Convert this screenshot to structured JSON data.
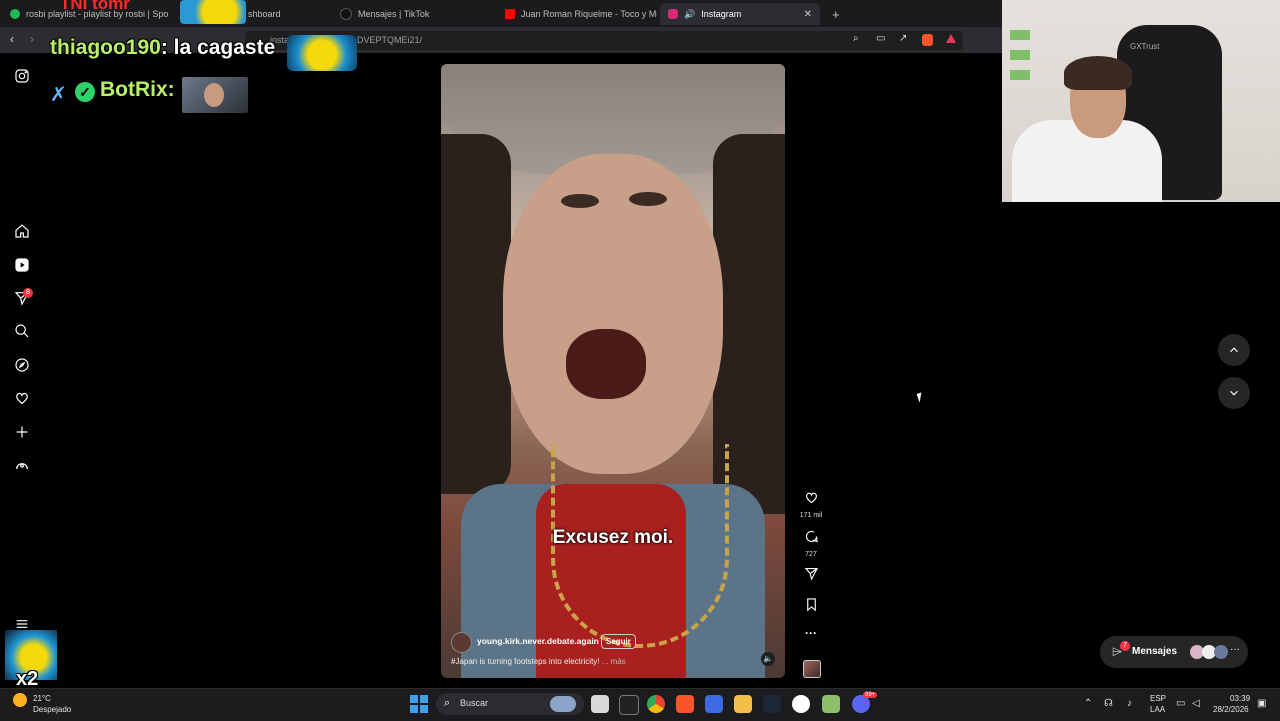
{
  "browser": {
    "tabs": [
      {
        "label": "rosbi playlist - playlist by rosbi | Spo",
        "color": "#1db954"
      },
      {
        "label": "shboard",
        "color": "#888888"
      },
      {
        "label": "Mensajes | TikTok",
        "color": "#111111"
      },
      {
        "label": "Juan Roman Riquelme - Toco y Me V",
        "color": "#ff0000"
      },
      {
        "label": "Instagram",
        "color": "#d62976"
      }
    ],
    "url_prefix": "insta",
    "url_suffix": "DVEPTQMEi21/"
  },
  "stream_overlay": {
    "chat_user1": "thiagoo190",
    "chat_msg1": ": la cagaste",
    "chat_user2": "BotRix:",
    "partial_text": "TNI tomr",
    "bottom_badge": "x2"
  },
  "sidebar": {
    "badge_count": "8"
  },
  "reel": {
    "caption_overlay": "Excusez moi.",
    "username": "young.kirk.never.debate.again",
    "follow_label": "Seguir",
    "description_hashtag": "#",
    "description_text": "Japan is turning footsteps into electricity!",
    "more_label": "... más",
    "likes": "171 mil",
    "comments": "727"
  },
  "messages_pill": {
    "label": "Mensajes",
    "badge": "7"
  },
  "taskbar": {
    "weather_temp": "21°C",
    "weather_desc": "Despejado",
    "search_placeholder": "Buscar",
    "lang_top": "ESP",
    "lang_bottom": "LAA",
    "time": "03:39",
    "date": "28/2/2026",
    "discord_badge": "99+"
  },
  "colors": {
    "accent_red": "#ff3040",
    "bg": "#000000"
  }
}
